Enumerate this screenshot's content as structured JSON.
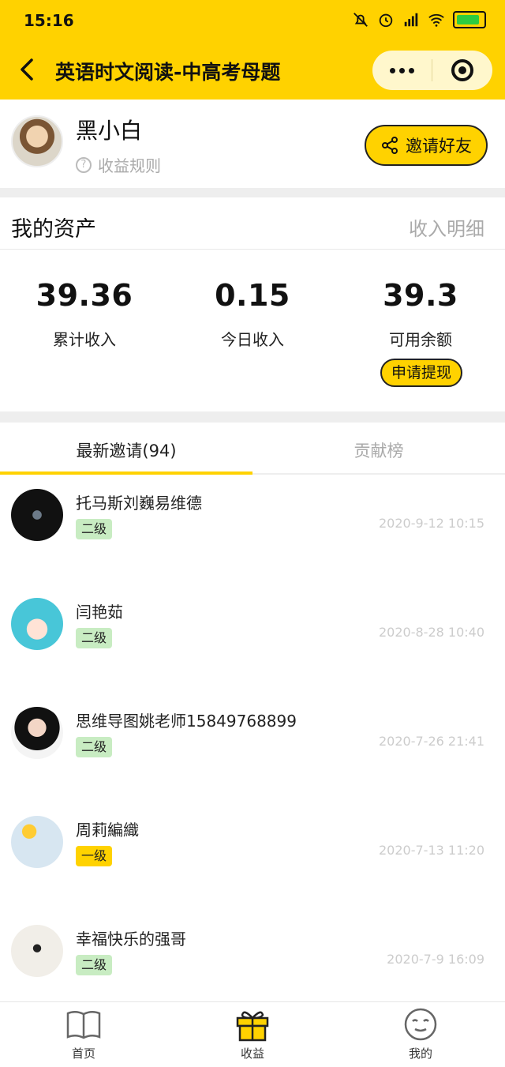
{
  "status_bar": {
    "time": "15:16"
  },
  "nav": {
    "title": "英语时文阅读-中高考母题"
  },
  "profile": {
    "name": "黑小白",
    "rules_label": "收益规则",
    "invite_label": "邀请好友"
  },
  "assets": {
    "heading": "我的资产",
    "detail_label": "收入明细",
    "total": {
      "value": "39.36",
      "label": "累计收入"
    },
    "today": {
      "value": "0.15",
      "label": "今日收入"
    },
    "available": {
      "value": "39.3",
      "label": "可用余额"
    },
    "withdraw_label": "申请提现"
  },
  "tabs": [
    {
      "label": "最新邀请(94)",
      "active": true
    },
    {
      "label": "贡献榜",
      "active": false
    }
  ],
  "invites": [
    {
      "name": "托马斯刘巍易维德",
      "level": "二级",
      "date": "2020-9-12 10:15"
    },
    {
      "name": "闫艳茹",
      "level": "二级",
      "date": "2020-8-28 10:40"
    },
    {
      "name": "思维导图姚老师15849768899",
      "level": "二级",
      "date": "2020-7-26 21:41"
    },
    {
      "name": "周莉編織",
      "level": "一级",
      "date": "2020-7-13 11:20"
    },
    {
      "name": "幸福快乐的强哥",
      "level": "二级",
      "date": "2020-7-9 16:09"
    }
  ],
  "bottom_tabs": [
    {
      "label": "首页",
      "icon": "book-icon"
    },
    {
      "label": "收益",
      "icon": "gift-icon"
    },
    {
      "label": "我的",
      "icon": "face-icon"
    }
  ],
  "colors": {
    "accent": "#FFD200",
    "level2_badge": "#c8ecc2",
    "level1_badge": "#FFD200"
  }
}
